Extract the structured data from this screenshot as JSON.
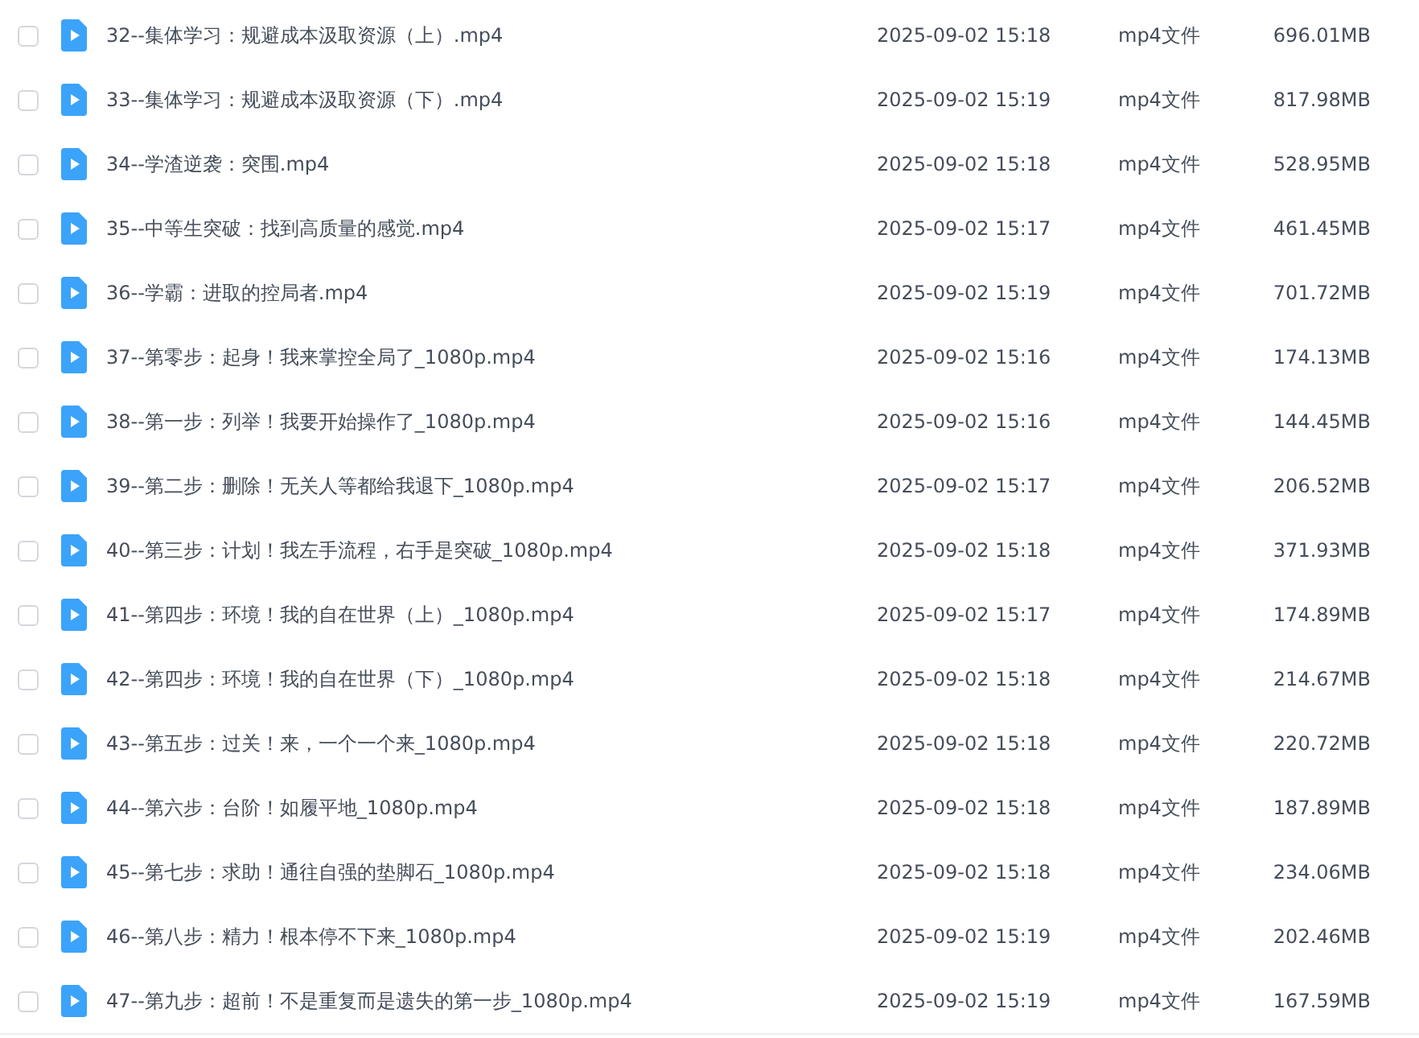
{
  "files": [
    {
      "name": "32--集体学习：规避成本汲取资源（上）.mp4",
      "modified": "2025-09-02 15:18",
      "type": "mp4文件",
      "size": "696.01MB",
      "checked": false
    },
    {
      "name": "33--集体学习：规避成本汲取资源（下）.mp4",
      "modified": "2025-09-02 15:19",
      "type": "mp4文件",
      "size": "817.98MB",
      "checked": false
    },
    {
      "name": "34--学渣逆袭：突围.mp4",
      "modified": "2025-09-02 15:18",
      "type": "mp4文件",
      "size": "528.95MB",
      "checked": false
    },
    {
      "name": "35--中等生突破：找到高质量的感觉.mp4",
      "modified": "2025-09-02 15:17",
      "type": "mp4文件",
      "size": "461.45MB",
      "checked": false
    },
    {
      "name": "36--学霸：进取的控局者.mp4",
      "modified": "2025-09-02 15:19",
      "type": "mp4文件",
      "size": "701.72MB",
      "checked": false
    },
    {
      "name": "37--第零步：起身！我来掌控全局了_1080p.mp4",
      "modified": "2025-09-02 15:16",
      "type": "mp4文件",
      "size": "174.13MB",
      "checked": false
    },
    {
      "name": "38--第一步：列举！我要开始操作了_1080p.mp4",
      "modified": "2025-09-02 15:16",
      "type": "mp4文件",
      "size": "144.45MB",
      "checked": false
    },
    {
      "name": "39--第二步：删除！无关人等都给我退下_1080p.mp4",
      "modified": "2025-09-02 15:17",
      "type": "mp4文件",
      "size": "206.52MB",
      "checked": false
    },
    {
      "name": "40--第三步：计划！我左手流程，右手是突破_1080p.mp4",
      "modified": "2025-09-02 15:18",
      "type": "mp4文件",
      "size": "371.93MB",
      "checked": false
    },
    {
      "name": "41--第四步：环境！我的自在世界（上）_1080p.mp4",
      "modified": "2025-09-02 15:17",
      "type": "mp4文件",
      "size": "174.89MB",
      "checked": false
    },
    {
      "name": "42--第四步：环境！我的自在世界（下）_1080p.mp4",
      "modified": "2025-09-02 15:18",
      "type": "mp4文件",
      "size": "214.67MB",
      "checked": false
    },
    {
      "name": "43--第五步：过关！来，一个一个来_1080p.mp4",
      "modified": "2025-09-02 15:18",
      "type": "mp4文件",
      "size": "220.72MB",
      "checked": false
    },
    {
      "name": "44--第六步：台阶！如履平地_1080p.mp4",
      "modified": "2025-09-02 15:18",
      "type": "mp4文件",
      "size": "187.89MB",
      "checked": false
    },
    {
      "name": "45--第七步：求助！通往自强的垫脚石_1080p.mp4",
      "modified": "2025-09-02 15:18",
      "type": "mp4文件",
      "size": "234.06MB",
      "checked": false
    },
    {
      "name": "46--第八步：精力！根本停不下来_1080p.mp4",
      "modified": "2025-09-02 15:19",
      "type": "mp4文件",
      "size": "202.46MB",
      "checked": false
    },
    {
      "name": "47--第九步：超前！不是重复而是遗失的第一步_1080p.mp4",
      "modified": "2025-09-02 15:19",
      "type": "mp4文件",
      "size": "167.59MB",
      "checked": false
    }
  ]
}
